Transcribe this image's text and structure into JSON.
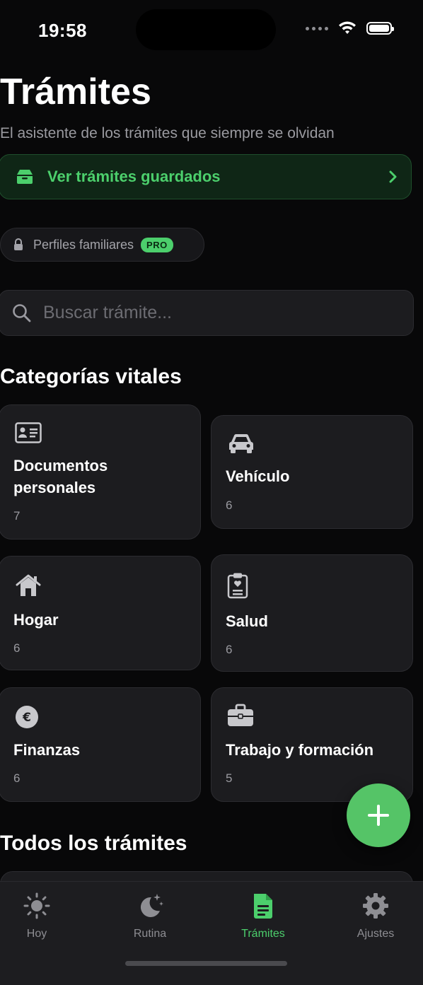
{
  "status_bar": {
    "time": "19:58"
  },
  "header": {
    "title": "Trámites",
    "subtitle": "El asistente de los trámites que siempre se olvidan"
  },
  "saved_button": {
    "label": "Ver trámites guardados",
    "icon": "tray-icon"
  },
  "family_profiles": {
    "label": "Perfiles familiares",
    "badge": "PRO"
  },
  "search": {
    "placeholder": "Buscar trámite...",
    "value": ""
  },
  "categories": {
    "title": "Categorías vitales",
    "items": [
      {
        "name": "Documentos personales",
        "count": "7",
        "icon": "id-card-icon"
      },
      {
        "name": "Vehículo",
        "count": "6",
        "icon": "car-icon"
      },
      {
        "name": "Hogar",
        "count": "6",
        "icon": "house-icon"
      },
      {
        "name": "Salud",
        "count": "6",
        "icon": "clipboard-heart-icon"
      },
      {
        "name": "Finanzas",
        "count": "6",
        "icon": "euro-icon"
      },
      {
        "name": "Trabajo y formación",
        "count": "5",
        "icon": "briefcase-icon"
      }
    ]
  },
  "all_procedures": {
    "title": "Todos los trámites"
  },
  "fab": {
    "icon": "plus-icon"
  },
  "tabs": [
    {
      "label": "Hoy",
      "icon": "sun-icon",
      "active": false
    },
    {
      "label": "Rutina",
      "icon": "moon-stars-icon",
      "active": false
    },
    {
      "label": "Trámites",
      "icon": "document-icon",
      "active": true
    },
    {
      "label": "Ajustes",
      "icon": "gear-icon",
      "active": false
    }
  ],
  "colors": {
    "accent": "#4ccf6c",
    "background": "#080809",
    "card": "#1c1c1f"
  }
}
